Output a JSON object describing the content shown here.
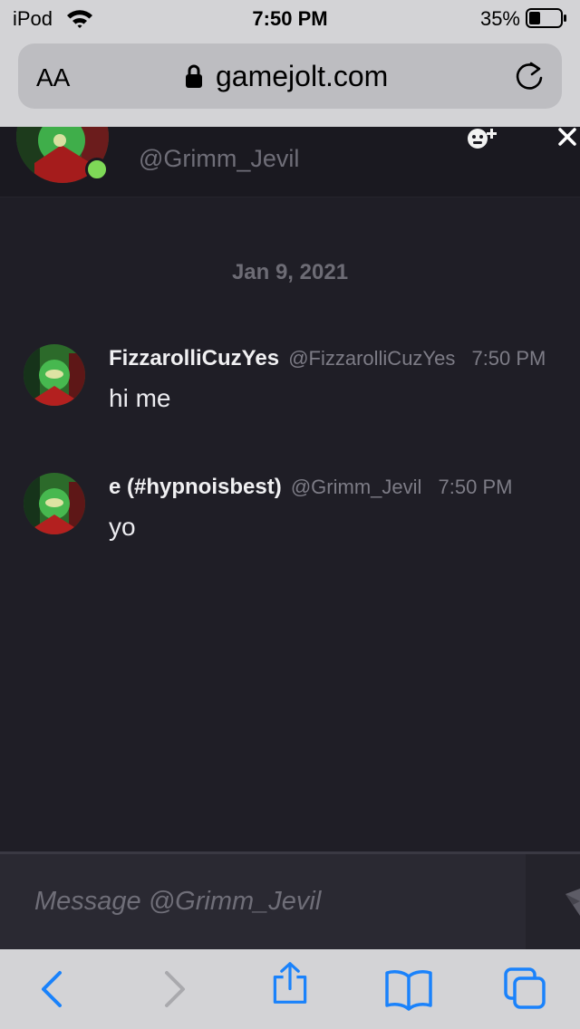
{
  "status_bar": {
    "carrier": "iPod",
    "time": "7:50 PM",
    "battery": "35%"
  },
  "browser": {
    "text_size": "AA",
    "domain": "gamejolt.com"
  },
  "chat_header": {
    "handle": "@Grimm_Jevil"
  },
  "conversation": {
    "date": "Jan 9, 2021",
    "messages": [
      {
        "name": "FizzarolliCuzYes",
        "handle": "@FizzarolliCuzYes",
        "time": "7:50 PM",
        "text": "hi me"
      },
      {
        "name": "e (#hypnoisbest)",
        "handle": "@Grimm_Jevil",
        "time": "7:50 PM",
        "text": "yo"
      }
    ]
  },
  "composer": {
    "placeholder": "Message @Grimm_Jevil"
  },
  "colors": {
    "ios_blue": "#1a82fb",
    "online": "#7ed957",
    "background": "#1f1e26"
  }
}
